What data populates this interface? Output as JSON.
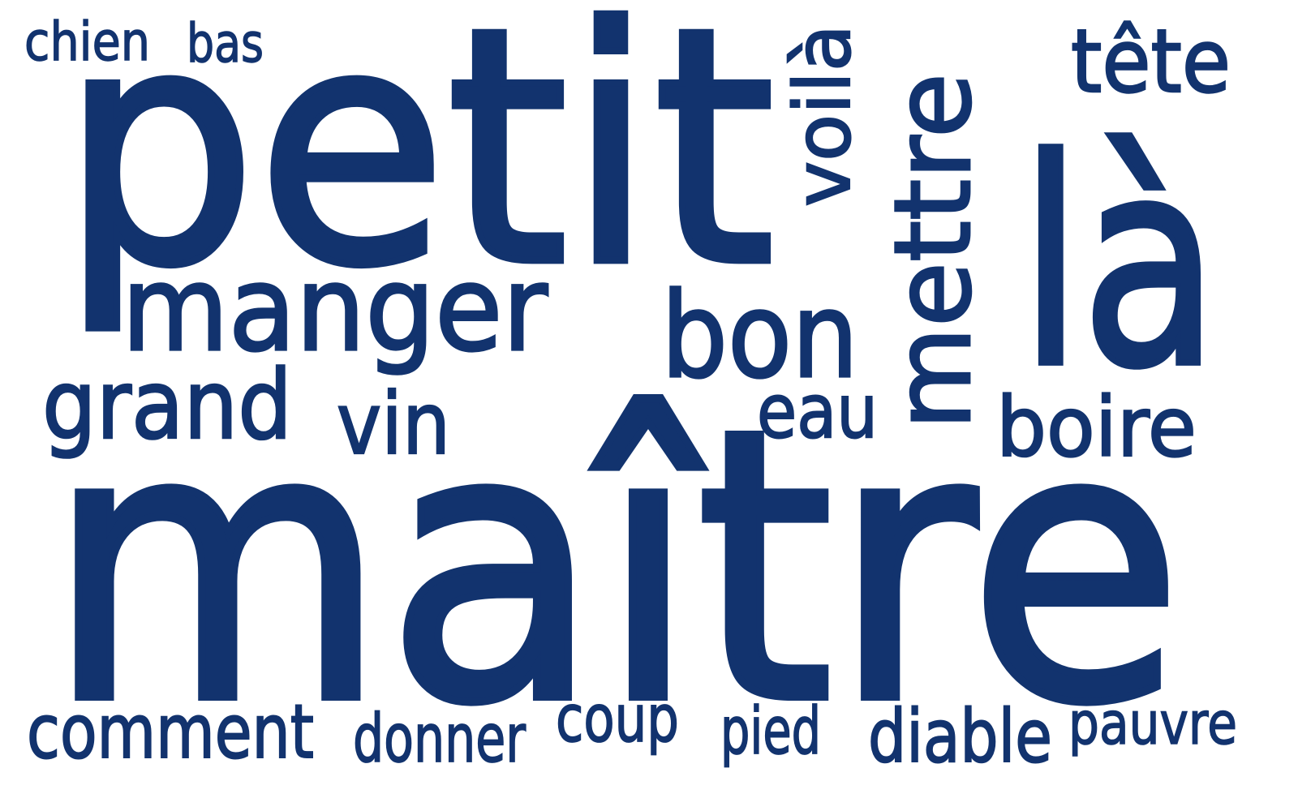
{
  "colors": {
    "text": "#12336e",
    "background": "#ffffff"
  },
  "words": {
    "maitre": "maître",
    "petit": "petit",
    "la": "là",
    "mettre": "mettre",
    "manger": "manger",
    "bon": "bon",
    "grand": "grand",
    "voila": "voilà",
    "tete": "tête",
    "boire": "boire",
    "vin": "vin",
    "eau": "eau",
    "comment": "comment",
    "diable": "diable",
    "chien": "chien",
    "bas": "bas",
    "donner": "donner",
    "coup": "coup",
    "pied": "pied",
    "pauvre": "pauvre"
  }
}
